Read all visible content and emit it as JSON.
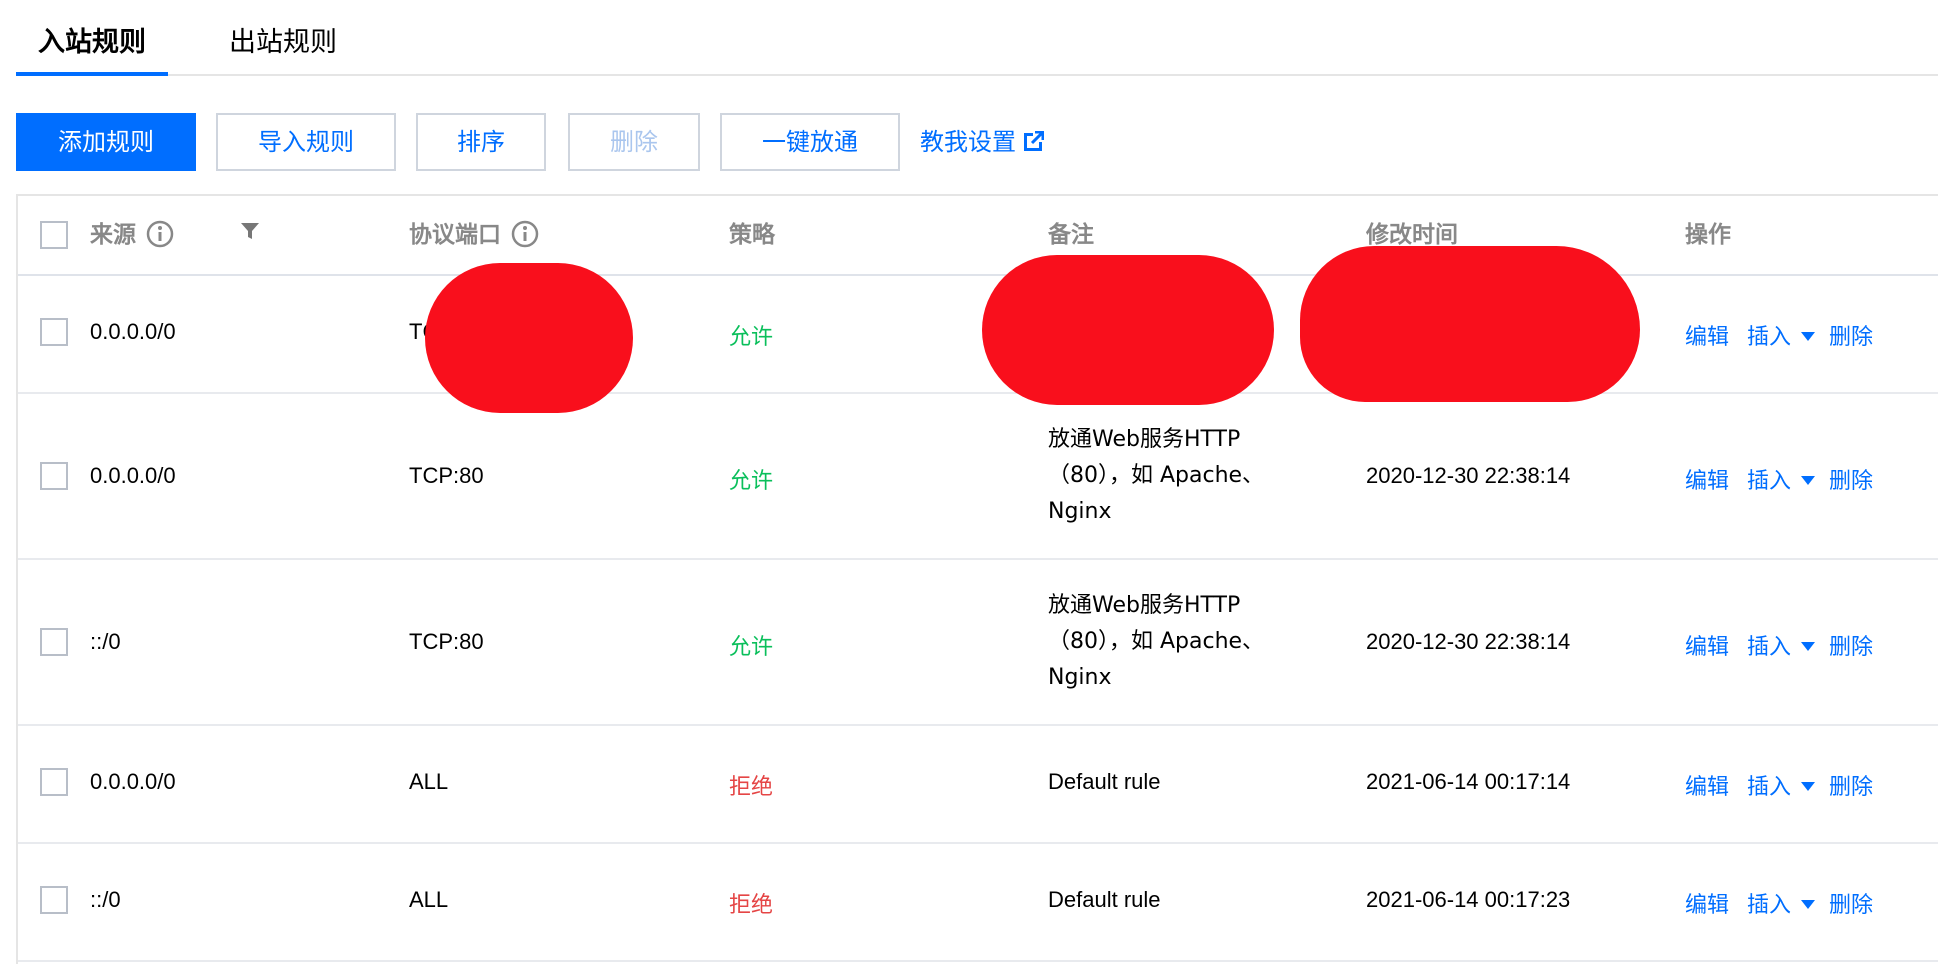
{
  "tabs": {
    "inbound": "入站规则",
    "outbound": "出站规则"
  },
  "toolbar": {
    "add_rule": "添加规则",
    "import_rules": "导入规则",
    "sort": "排序",
    "delete": "删除",
    "allow_all": "一键放通",
    "help": "教我设置"
  },
  "table": {
    "headers": {
      "source": "来源",
      "protocol_port": "协议端口",
      "policy": "策略",
      "note": "备注",
      "modified_time": "修改时间",
      "actions": "操作"
    },
    "row_actions": {
      "edit": "编辑",
      "insert": "插入",
      "delete": "删除"
    },
    "rows": [
      {
        "source": "0.0.0.0/0",
        "protocol_port": "TC",
        "policy": "允许",
        "note": "",
        "modified_time": ""
      },
      {
        "source": "0.0.0.0/0",
        "protocol_port": "TCP:80",
        "policy": "允许",
        "note": "放通Web服务HTTP（80），如 Apache、Nginx",
        "modified_time": "2020-12-30 22:38:14"
      },
      {
        "source": "::/0",
        "protocol_port": "TCP:80",
        "policy": "允许",
        "note": "放通Web服务HTTP（80），如 Apache、Nginx",
        "modified_time": "2020-12-30 22:38:14"
      },
      {
        "source": "0.0.0.0/0",
        "protocol_port": "ALL",
        "policy": "拒绝",
        "note": "Default rule",
        "modified_time": "2021-06-14 00:17:14"
      },
      {
        "source": "::/0",
        "protocol_port": "ALL",
        "policy": "拒绝",
        "note": "Default rule",
        "modified_time": "2021-06-14 00:17:23"
      }
    ]
  },
  "colors": {
    "primary": "#006eff",
    "allow": "#0abf5b",
    "deny": "#e54545",
    "redaction": "#f90f1c"
  }
}
